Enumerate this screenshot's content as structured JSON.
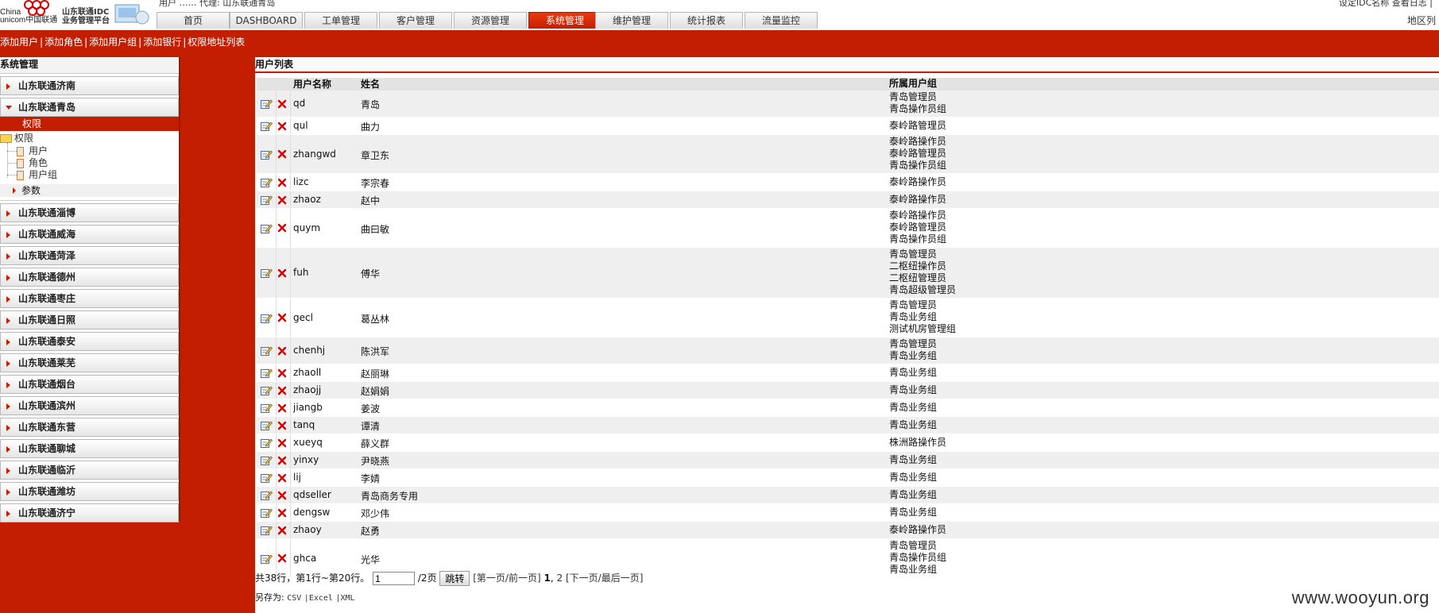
{
  "header": {
    "brand_en_1": "China",
    "brand_en_2": "unicom中国联通",
    "platform_line1": "山东联通IDC",
    "platform_line2": "业务管理平台",
    "top_info": "用户 …… 代理: 山东联通青岛",
    "top_right": "设定IDC名称  查看日志  |",
    "region_label": "地区列"
  },
  "nav": {
    "tabs": [
      {
        "label": "首页"
      },
      {
        "label": "DASHBOARD"
      },
      {
        "label": "工单管理"
      },
      {
        "label": "客户管理"
      },
      {
        "label": "资源管理"
      },
      {
        "label": "系统管理",
        "active": true
      },
      {
        "label": "维护管理"
      },
      {
        "label": "统计报表"
      },
      {
        "label": "流量监控"
      }
    ]
  },
  "actions": {
    "add_user": "添加用户",
    "add_role": "添加角色",
    "add_group": "添加用户组",
    "add_bank": "添加银行",
    "perm_list": "权限地址列表",
    "separator": "|"
  },
  "sidebar": {
    "title": "系统管理",
    "region_first": "山东联通济南",
    "region_open": "山东联通青岛",
    "perm_header": "权限",
    "tree_root": "权限",
    "tree_items": [
      "用户",
      "角色",
      "用户组"
    ],
    "params": "参数",
    "regions_rest": [
      "山东联通淄博",
      "山东联通威海",
      "山东联通菏泽",
      "山东联通德州",
      "山东联通枣庄",
      "山东联通日照",
      "山东联通泰安",
      "山东联通莱芜",
      "山东联通烟台",
      "山东联通滨州",
      "山东联通东营",
      "山东联通聊城",
      "山东联通临沂",
      "山东联通潍坊",
      "山东联通济宁"
    ]
  },
  "main": {
    "title": "用户列表",
    "columns": {
      "username": "用户名称",
      "name": "姓名",
      "group": "所属用户组"
    },
    "rows": [
      {
        "username": "qd",
        "name": "青岛",
        "groups": [
          "青岛管理员",
          "青岛操作员组"
        ]
      },
      {
        "username": "qul",
        "name": "曲力",
        "groups": [
          "泰岭路管理员"
        ]
      },
      {
        "username": "zhangwd",
        "name": "章卫东",
        "groups": [
          "泰岭路操作员",
          "泰岭路管理员",
          "青岛操作员组"
        ]
      },
      {
        "username": "lizc",
        "name": "李宗春",
        "groups": [
          "泰岭路操作员"
        ]
      },
      {
        "username": "zhaoz",
        "name": "赵中",
        "groups": [
          "泰岭路操作员"
        ]
      },
      {
        "username": "quym",
        "name": "曲曰敏",
        "groups": [
          "泰岭路操作员",
          "泰岭路管理员",
          "青岛操作员组"
        ]
      },
      {
        "username": "fuh",
        "name": "傅华",
        "groups": [
          "青岛管理员",
          "二枢纽操作员",
          "二枢纽管理员",
          "青岛超级管理员"
        ]
      },
      {
        "username": "gecl",
        "name": "葛丛林",
        "groups": [
          "青岛管理员",
          "青岛业务组",
          "测试机房管理组"
        ]
      },
      {
        "username": "chenhj",
        "name": "陈洪军",
        "groups": [
          "青岛管理员",
          "青岛业务组"
        ]
      },
      {
        "username": "zhaoll",
        "name": "赵丽琳",
        "groups": [
          "青岛业务组"
        ]
      },
      {
        "username": "zhaojj",
        "name": "赵娟娟",
        "groups": [
          "青岛业务组"
        ]
      },
      {
        "username": "jiangb",
        "name": "姜波",
        "groups": [
          "青岛业务组"
        ]
      },
      {
        "username": "tanq",
        "name": "谭清",
        "groups": [
          "青岛业务组"
        ]
      },
      {
        "username": "xueyq",
        "name": "薛义群",
        "groups": [
          "株洲路操作员"
        ]
      },
      {
        "username": "yinxy",
        "name": "尹晓燕",
        "groups": [
          "青岛业务组"
        ]
      },
      {
        "username": "lij",
        "name": "李婧",
        "groups": [
          "青岛业务组"
        ]
      },
      {
        "username": "qdseller",
        "name": "青岛商务专用",
        "groups": [
          "青岛业务组"
        ]
      },
      {
        "username": "dengsw",
        "name": "邓少伟",
        "groups": [
          "青岛业务组"
        ]
      },
      {
        "username": "zhaoy",
        "name": "赵勇",
        "groups": [
          "泰岭路操作员"
        ]
      },
      {
        "username": "ghca",
        "name": "光华",
        "groups": [
          "青岛管理员",
          "青岛操作员组",
          "青岛业务组"
        ]
      }
    ]
  },
  "pager": {
    "summary": "共38行，第1行~第20行。",
    "page_input": "1",
    "total_pages": "/2页",
    "jump_label": "跳转",
    "first_prev": "[第一页/前一页]",
    "page1": "1",
    "comma": ",",
    "page2": "2",
    "next_last": "[下一页/最后一页]"
  },
  "export": {
    "label": "另存为:",
    "formats": [
      "CSV",
      "Excel",
      "XML"
    ],
    "separator": "|"
  },
  "watermark": "www.wooyun.org",
  "colors": {
    "accent": "#c41e00",
    "row_alt": "#efefef",
    "header_gray": "#e3e3e3"
  }
}
